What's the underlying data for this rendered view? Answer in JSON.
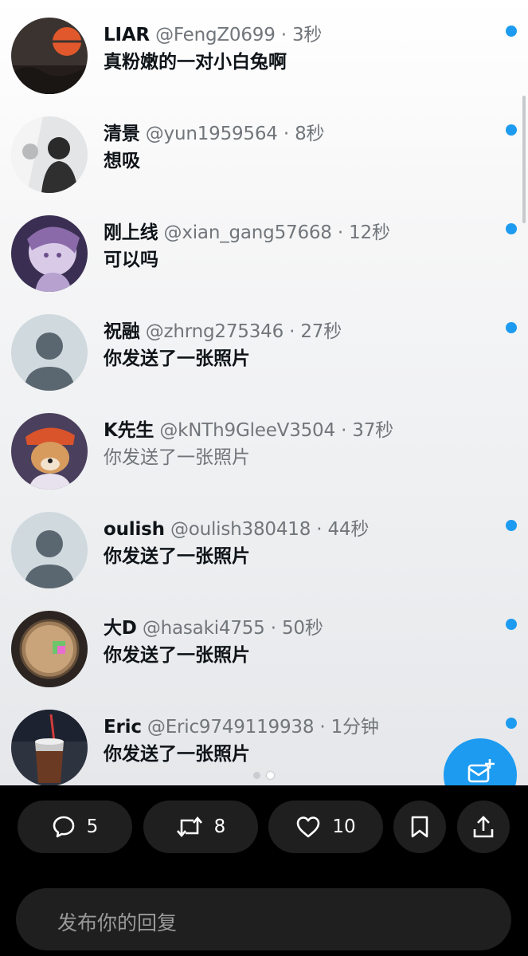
{
  "conversations": [
    {
      "name": "LIAR",
      "handle": "@FengZ0699",
      "time": "· 3秒",
      "message": "真粉嫩的一对小白兔啊",
      "unread": true,
      "avatar": "sunset-avatar"
    },
    {
      "name": "清景",
      "handle": "@yun1959564",
      "time": "· 8秒",
      "message": "想吸",
      "unread": true,
      "avatar": "person-shadow-avatar"
    },
    {
      "name": "刚上线",
      "handle": "@xian_gang57668",
      "time": "· 12秒",
      "message": "可以吗",
      "unread": true,
      "avatar": "anime-avatar"
    },
    {
      "name": "祝融",
      "handle": "@zhrng275346",
      "time": "· 27秒",
      "message": "你发送了一张照片",
      "unread": true,
      "avatar": "default-avatar"
    },
    {
      "name": "K先生",
      "handle": "@kNTh9GleeV3504",
      "time": "· 37秒",
      "message": "你发送了一张照片",
      "unread": false,
      "avatar": "dog-avatar"
    },
    {
      "name": "oulish",
      "handle": "@oulish380418",
      "time": "· 44秒",
      "message": "你发送了一张照片",
      "unread": true,
      "avatar": "default-avatar"
    },
    {
      "name": "大D",
      "handle": "@hasaki4755",
      "time": "· 50秒",
      "message": "你发送了一张照片",
      "unread": true,
      "avatar": "coin-avatar"
    },
    {
      "name": "Eric",
      "handle": "@Eric9749119938",
      "time": "· 1分钟",
      "message": "你发送了一张照片",
      "unread": true,
      "avatar": "drink-avatar"
    }
  ],
  "fab_icon": "new-message-icon",
  "actions": {
    "reply_count": "5",
    "repost_count": "8",
    "like_count": "10",
    "bookmark_icon": "bookmark-icon",
    "share_icon": "share-icon"
  },
  "reply_input": {
    "placeholder": "发布你的回复"
  },
  "colors": {
    "accent": "#1d9bf0",
    "name": "#0f1419",
    "meta": "#71767b",
    "bar": "#1f1f1f"
  }
}
